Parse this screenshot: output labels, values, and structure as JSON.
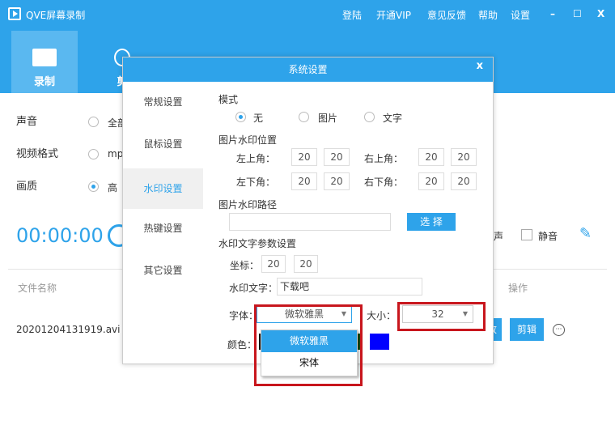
{
  "window": {
    "title": "QVE屏幕录制",
    "menu": [
      "登陆",
      "开通VIP",
      "意见反馈",
      "帮助",
      "设置"
    ],
    "min": "–",
    "max": "☐",
    "close": "X"
  },
  "tabs": [
    {
      "label": "录制"
    },
    {
      "label": "剪"
    }
  ],
  "settings": {
    "sound_label": "声音",
    "sound_opt": "全部",
    "format_label": "视频格式",
    "format_opt": "mp",
    "quality_label": "画质",
    "quality_opt": "高"
  },
  "timer": "00:00:00",
  "right_controls": {
    "partial": "声",
    "mute": "静音"
  },
  "files": {
    "col_name": "文件名称",
    "col_ops": "操作",
    "rows": [
      {
        "name": "20201204131919.avi",
        "btn_partial": "改",
        "edit": "剪辑"
      }
    ]
  },
  "dialog": {
    "title": "系统设置",
    "close": "x",
    "nav": [
      "常规设置",
      "鼠标设置",
      "水印设置",
      "热键设置",
      "其它设置"
    ],
    "mode_label": "模式",
    "modes": [
      "无",
      "图片",
      "文字"
    ],
    "pos_label": "图片水印位置",
    "tl": "左上角：",
    "tr": "右上角：",
    "bl": "左下角：",
    "br": "右下角：",
    "vals": {
      "tl": [
        "20",
        "20"
      ],
      "tr": [
        "20",
        "20"
      ],
      "bl": [
        "20",
        "20"
      ],
      "br": [
        "20",
        "20"
      ]
    },
    "path_label": "图片水印路径",
    "path_value": "",
    "choose": "选 择",
    "text_params": "水印文字参数设置",
    "coord_label": "坐标：",
    "coord": [
      "20",
      "20"
    ],
    "text_label": "水印文字：",
    "text_value": "下载吧",
    "font_label": "字体：",
    "font_value": "微软雅黑",
    "size_label": "大小：",
    "size_value": "32",
    "color_label": "颜色：",
    "font_options": [
      "微软雅黑",
      "宋体"
    ],
    "colors": {
      "swatch1": "#111111",
      "swatch2": "#0000ff"
    }
  },
  "accent": "#2ea3ea"
}
